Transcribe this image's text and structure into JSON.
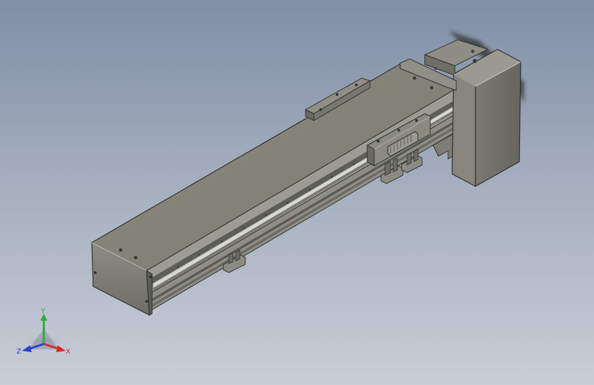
{
  "triad": {
    "x_label": "X",
    "y_label": "Y",
    "z_label": "Z"
  },
  "colors": {
    "background_top": "#7f8fa6",
    "background_bottom": "#c9ced7",
    "x_axis": "#d42a2a",
    "y_axis": "#2fa83a",
    "z_axis": "#2a3fd4",
    "part_body": "#7f7f73"
  }
}
